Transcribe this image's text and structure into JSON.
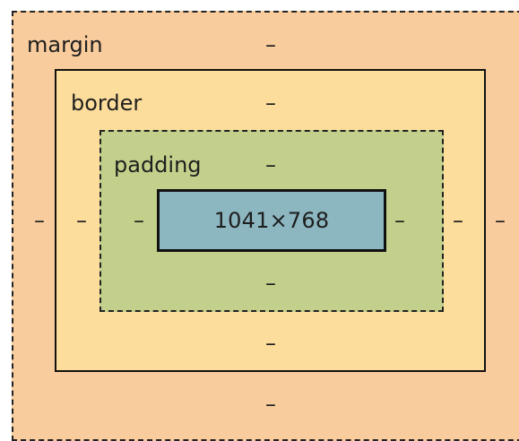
{
  "box_model": {
    "margin": {
      "label": "margin",
      "top": "–",
      "right": "–",
      "bottom": "–",
      "left": "–"
    },
    "border": {
      "label": "border",
      "top": "–",
      "right": "–",
      "bottom": "–",
      "left": "–"
    },
    "padding": {
      "label": "padding",
      "top": "–",
      "right": "–",
      "bottom": "–",
      "left": "–"
    },
    "content": {
      "size": "1041×768"
    }
  }
}
